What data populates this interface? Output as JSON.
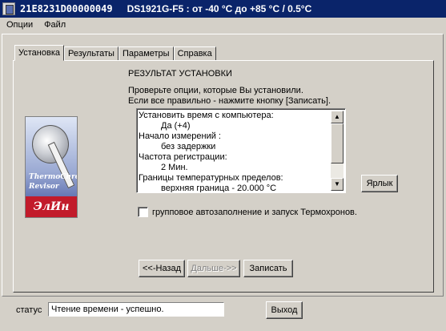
{
  "window": {
    "title_id": "21E8231D00000049",
    "title_desc": "DS1921G-F5 : от -40 °С до +85 °С / 0.5°С"
  },
  "menu": [
    "Опции",
    "Файл"
  ],
  "tabs": [
    {
      "label": "Установка",
      "active": true
    },
    {
      "label": "Результаты",
      "active": false
    },
    {
      "label": "Параметры",
      "active": false
    },
    {
      "label": "Справка",
      "active": false
    }
  ],
  "logo": {
    "line1": "ThermoChron",
    "line2": "Revisor",
    "brand": "ЭлИн"
  },
  "main": {
    "heading": "РЕЗУЛЬТАТ УСТАНОВКИ",
    "instruction1": "Проверьте опции, которые Вы установили.",
    "instruction2": "Если все правильно - нажмите кнопку [Записать].",
    "summary": [
      {
        "text": "Установить время с компьютера:",
        "indent": false
      },
      {
        "text": "Да (+4)",
        "indent": true
      },
      {
        "text": "Начало измерений :",
        "indent": false
      },
      {
        "text": "без задержки",
        "indent": true
      },
      {
        "text": "Частота регистрации:",
        "indent": false
      },
      {
        "text": "2 Мин.",
        "indent": true
      },
      {
        "text": "Границы температурных пределов:",
        "indent": false
      },
      {
        "text": "верхняя граница -  20.000 °С",
        "indent": true
      }
    ],
    "label_button": "Ярлык",
    "autofill_label": "групповое автозаполнение и запуск Термохронов.",
    "autofill_checked": false,
    "back_button": "<<-Назад",
    "next_button": "Дальше->>",
    "write_button": "Записать"
  },
  "footer": {
    "status_label": "статус",
    "status_value": "Чтение времени - успешно.",
    "exit_button": "Выход"
  },
  "colors": {
    "titlebar": "#0a246a",
    "face": "#d4d0c8",
    "brand_red": "#c21b2b"
  }
}
